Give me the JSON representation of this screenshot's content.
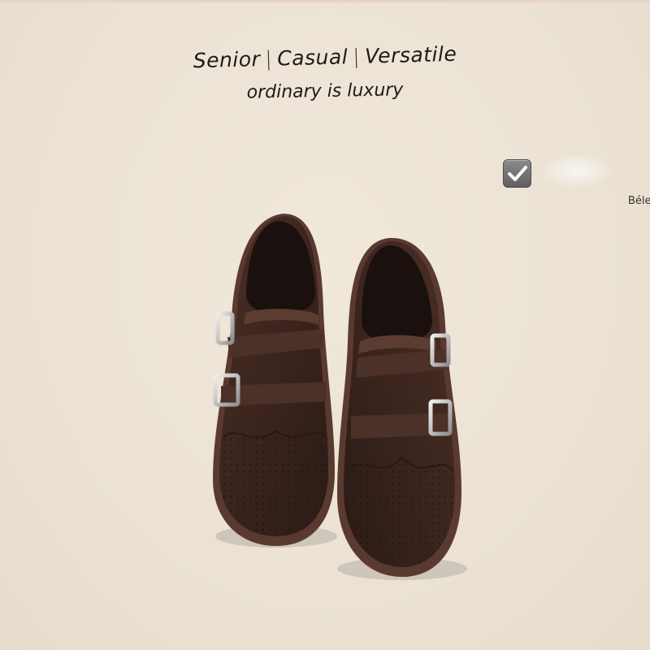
{
  "headline": {
    "line1_words": [
      "Senior",
      "Casual",
      "Versatile"
    ],
    "separator": "|",
    "line2": "ordinary is luxury"
  },
  "checkbox": {
    "checked": true,
    "icon": "checkmark-icon"
  },
  "side_text": "Béle",
  "colors": {
    "background": "#ede4d6",
    "leather": "#3d2720",
    "sole": "#5a3a30",
    "buckle": "#c9c9c9"
  },
  "image_subject": "brown monk-strap brogue shoes"
}
